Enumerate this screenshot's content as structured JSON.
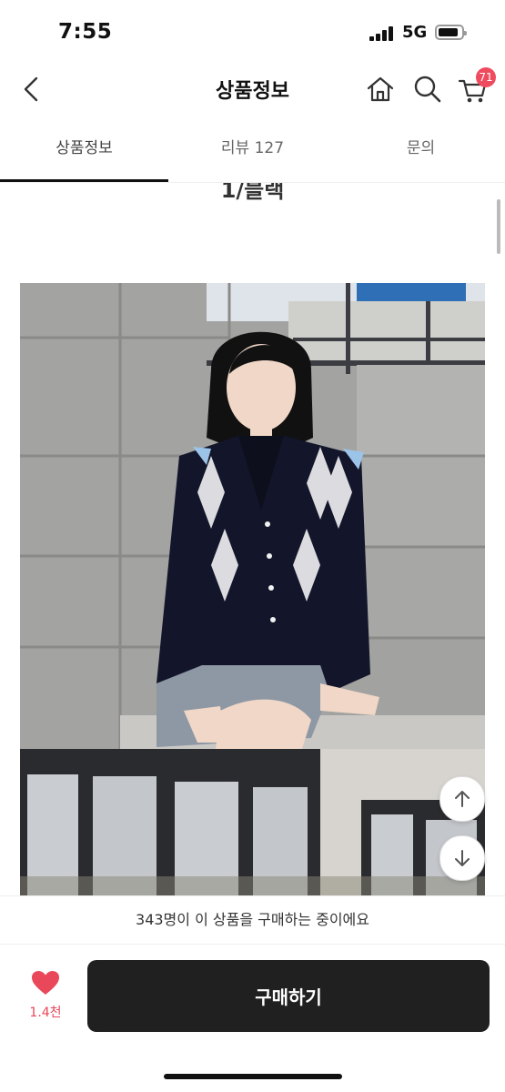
{
  "status_bar": {
    "time": "7:55",
    "network": "5G"
  },
  "header": {
    "title": "상품정보",
    "cart_count": "71"
  },
  "tabs": [
    {
      "label": "상품정보"
    },
    {
      "label": "리뷰 127"
    },
    {
      "label": "문의"
    }
  ],
  "content": {
    "heading": "1/블랙"
  },
  "notice": {
    "text": "343명이 이 상품을 구매하는 중이에요"
  },
  "footer": {
    "like_count": "1.4천",
    "buy_label": "구매하기"
  },
  "colors": {
    "accent": "#ef4b5f",
    "buy_button": "#202020"
  }
}
